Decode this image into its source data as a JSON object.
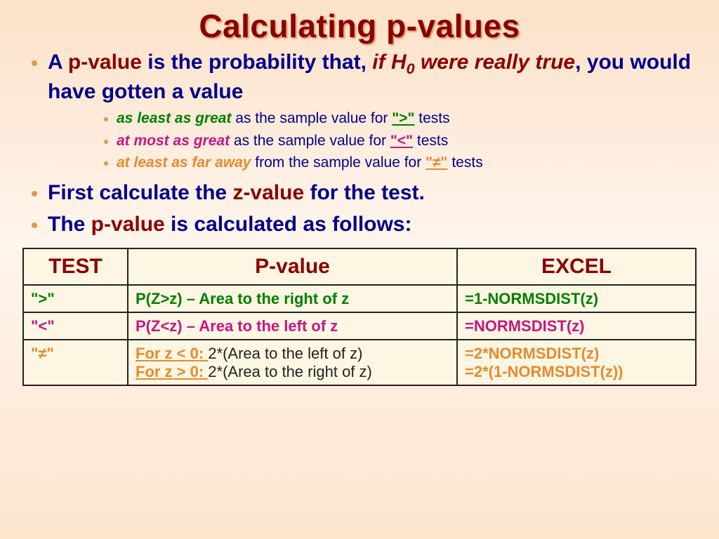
{
  "title": "Calculating p-values",
  "b1": {
    "a": "A ",
    "pv": "p-value",
    "mid": " is the probability that, ",
    "hyp1": "if H",
    "hyp_sub": "0",
    "hyp2": " were really true",
    "end": ", you would have gotten a value"
  },
  "s1": {
    "em": "as least as great",
    "txt": " as the sample value for ",
    "sym": "\">\"",
    "tail": " tests"
  },
  "s2": {
    "em": "at most as great",
    "txt": " as the sample value for ",
    "sym": "\"<\"",
    "tail": " tests"
  },
  "s3": {
    "em": "at least as far away",
    "txt": " from the sample value for ",
    "sym": "\"≠\"",
    "tail": " tests"
  },
  "b2": {
    "a": "First calculate the ",
    "zv": "z-value",
    "end": " for the test."
  },
  "b3": {
    "a": "The ",
    "pv": "p-value",
    "end": " is calculated as follows:"
  },
  "th": {
    "test": "TEST",
    "pval": "P-value",
    "excel": "EXCEL"
  },
  "r1": {
    "test": "\">\"",
    "pval": "P(Z>z) – Area to the right of z",
    "excel": "=1-NORMSDIST(z)"
  },
  "r2": {
    "test": "\"<\"",
    "pval": "P(Z<z) – Area to the left of z",
    "excel": "=NORMSDIST(z)"
  },
  "r3": {
    "test": "\"≠\"",
    "p1a": "For z < 0: ",
    "p1b": "2*(Area to the left of z)",
    "p2a": "For z > 0: ",
    "p2b": "2*(Area to the right of z)",
    "e1": "=2*NORMSDIST(z)",
    "e2": "=2*(1-NORMSDIST(z))"
  }
}
